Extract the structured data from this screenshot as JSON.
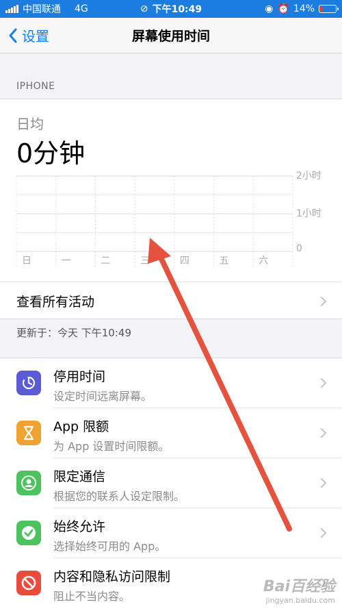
{
  "status_bar": {
    "carrier": "中国联通",
    "network": "4G",
    "time": "下午10:49",
    "battery_percent": "14%",
    "battery_level": 0.14
  },
  "nav": {
    "back_label": "设置",
    "title": "屏幕使用时间"
  },
  "section_header": "IPHONE",
  "summary": {
    "avg_label": "日均",
    "avg_value": "0分钟"
  },
  "chart_data": {
    "type": "bar",
    "categories": [
      "日",
      "一",
      "二",
      "三",
      "四",
      "五",
      "六"
    ],
    "values": [
      0,
      0,
      0,
      0,
      0,
      0,
      0
    ],
    "y_tick_labels": [
      "2小时",
      "1小时",
      "0"
    ],
    "ylim": [
      0,
      2
    ],
    "grid": true
  },
  "see_all": "查看所有活动",
  "updated_text": "更新于：今天 下午10:49",
  "list_items": [
    {
      "title": "停用时间",
      "subtitle": "设定时间远离屏幕。",
      "icon": "downtime-icon",
      "color": "#5b5bd6"
    },
    {
      "title": "App 限额",
      "subtitle": "为 App 设置时间限额。",
      "icon": "hourglass-icon",
      "color": "#f0a233"
    },
    {
      "title": "限定通信",
      "subtitle": "根据您的联系人设定限制。",
      "icon": "contact-icon",
      "color": "#4cc35e"
    },
    {
      "title": "始终允许",
      "subtitle": "选择始终可用的 App。",
      "icon": "checkmark-badge-icon",
      "color": "#4cc35e"
    },
    {
      "title": "内容和隐私访问限制",
      "subtitle": "阻止不当内容。",
      "icon": "prohibited-icon",
      "color": "#e94b3c"
    }
  ],
  "colors": {
    "status_bar_bg": "#1a7ddf",
    "accent": "#147efb",
    "arrow": "#e5533f"
  },
  "watermark": {
    "logo": "Bai百经验",
    "url": "jingyan.baidu.com"
  }
}
